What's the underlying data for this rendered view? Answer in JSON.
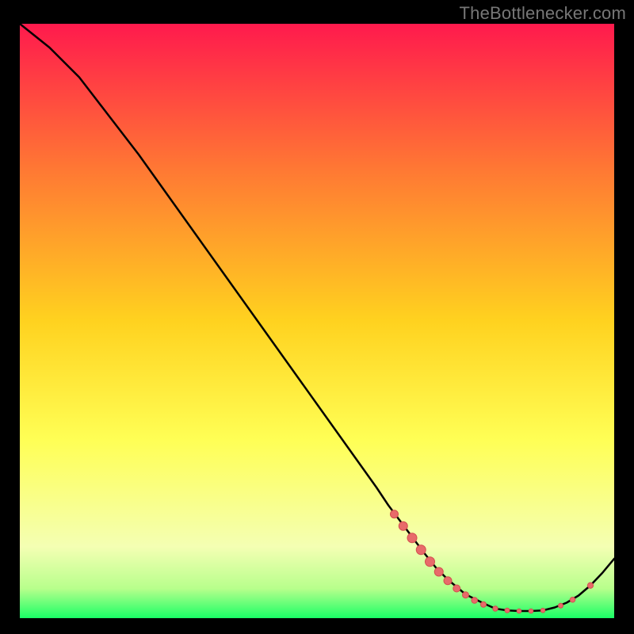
{
  "attribution": "TheBottlenecker.com",
  "colors": {
    "grad_top": "#ff1a4d",
    "grad_mid1": "#ff7a33",
    "grad_mid2": "#ffd21f",
    "grad_mid3": "#ffff55",
    "grad_low1": "#f4ffb3",
    "grad_low2": "#b8ff8c",
    "grad_bottom": "#1aff66",
    "curve": "#000000",
    "marker": "#e86a6a",
    "marker_stroke": "#d34f4f"
  },
  "chart_data": {
    "type": "line",
    "title": "",
    "xlabel": "",
    "ylabel": "",
    "xlim": [
      0,
      100
    ],
    "ylim": [
      0,
      100
    ],
    "series": [
      {
        "name": "curve",
        "x": [
          0,
          5,
          10,
          15,
          20,
          25,
          30,
          35,
          40,
          45,
          50,
          55,
          60,
          62,
          65,
          68,
          70,
          72,
          75,
          78,
          80,
          82,
          84,
          86,
          88,
          90,
          92,
          94,
          96,
          98,
          100
        ],
        "y": [
          100,
          96,
          91,
          84.5,
          78,
          71,
          64,
          57,
          50,
          43,
          36,
          29,
          22,
          19,
          15,
          11,
          8.5,
          6.5,
          4,
          2.5,
          1.6,
          1.3,
          1.2,
          1.2,
          1.3,
          1.8,
          2.6,
          3.8,
          5.5,
          7.6,
          10
        ]
      }
    ],
    "markers": {
      "name": "bottleneck-points",
      "points": [
        {
          "x": 63,
          "y": 17.5,
          "r": 5
        },
        {
          "x": 64.5,
          "y": 15.5,
          "r": 5.5
        },
        {
          "x": 66,
          "y": 13.5,
          "r": 6
        },
        {
          "x": 67.5,
          "y": 11.5,
          "r": 6
        },
        {
          "x": 69,
          "y": 9.5,
          "r": 6
        },
        {
          "x": 70.5,
          "y": 7.8,
          "r": 5.5
        },
        {
          "x": 72,
          "y": 6.3,
          "r": 5
        },
        {
          "x": 73.5,
          "y": 5,
          "r": 4.5
        },
        {
          "x": 75,
          "y": 3.9,
          "r": 4
        },
        {
          "x": 76.5,
          "y": 3,
          "r": 3.8
        },
        {
          "x": 78,
          "y": 2.3,
          "r": 3.5
        },
        {
          "x": 80,
          "y": 1.6,
          "r": 3.2
        },
        {
          "x": 82,
          "y": 1.3,
          "r": 3
        },
        {
          "x": 84,
          "y": 1.2,
          "r": 2.8
        },
        {
          "x": 86,
          "y": 1.2,
          "r": 2.8
        },
        {
          "x": 88,
          "y": 1.3,
          "r": 2.8
        },
        {
          "x": 91,
          "y": 2.1,
          "r": 3
        },
        {
          "x": 93,
          "y": 3.1,
          "r": 3.3
        },
        {
          "x": 96,
          "y": 5.5,
          "r": 3.6
        }
      ]
    }
  }
}
